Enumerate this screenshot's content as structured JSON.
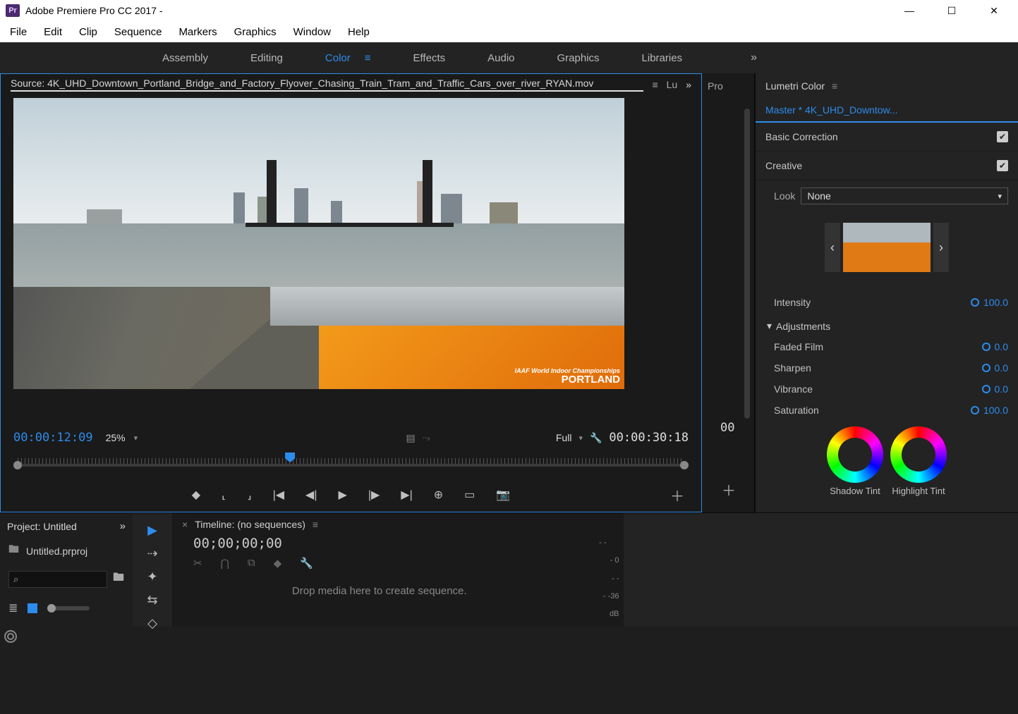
{
  "titlebar": {
    "app": "Adobe Premiere Pro CC 2017 - ",
    "icon_text": "Pr"
  },
  "menu": {
    "file": "File",
    "edit": "Edit",
    "clip": "Clip",
    "sequence": "Sequence",
    "markers": "Markers",
    "graphics": "Graphics",
    "window": "Window",
    "help": "Help"
  },
  "workspaces": {
    "assembly": "Assembly",
    "editing": "Editing",
    "color": "Color",
    "effects": "Effects",
    "audio": "Audio",
    "graphics": "Graphics",
    "libraries": "Libraries"
  },
  "source": {
    "tab_prefix": "Source: ",
    "filename": "4K_UHD_Downtown_Portland_Bridge_and_Factory_Flyover_Chasing_Train_Tram_and_Traffic_Cars_over_river_RYAN.mov",
    "other_tab_a": "Lu",
    "other_tab_b": "Pro",
    "tc_left": "00:00:12:09",
    "zoom": "25%",
    "resolution": "Full",
    "tc_right": "00:00:30:18",
    "filler_tc": "00",
    "billboard_small": "IAAF World Indoor Championships",
    "billboard_big": "PORTLAND"
  },
  "lumetri": {
    "title": "Lumetri Color",
    "master": "Master * 4K_UHD_Downtow...",
    "basic": "Basic Correction",
    "creative": "Creative",
    "look_label": "Look",
    "look_value": "None",
    "intensity": {
      "label": "Intensity",
      "value": "100.0"
    },
    "adjustments": "Adjustments",
    "faded": {
      "label": "Faded Film",
      "value": "0.0"
    },
    "sharpen": {
      "label": "Sharpen",
      "value": "0.0"
    },
    "vibrance": {
      "label": "Vibrance",
      "value": "0.0"
    },
    "saturation": {
      "label": "Saturation",
      "value": "100.0"
    },
    "shadow_tint": "Shadow Tint",
    "highlight_tint": "Highlight Tint"
  },
  "project": {
    "title": "Project: Untitled",
    "file": "Untitled.prproj"
  },
  "timeline": {
    "title": "Timeline: (no sequences)",
    "tc": "00;00;00;00",
    "drop": "Drop media here to create sequence."
  },
  "meters": {
    "zero": "0",
    "neg36": "-36",
    "db": "dB"
  }
}
